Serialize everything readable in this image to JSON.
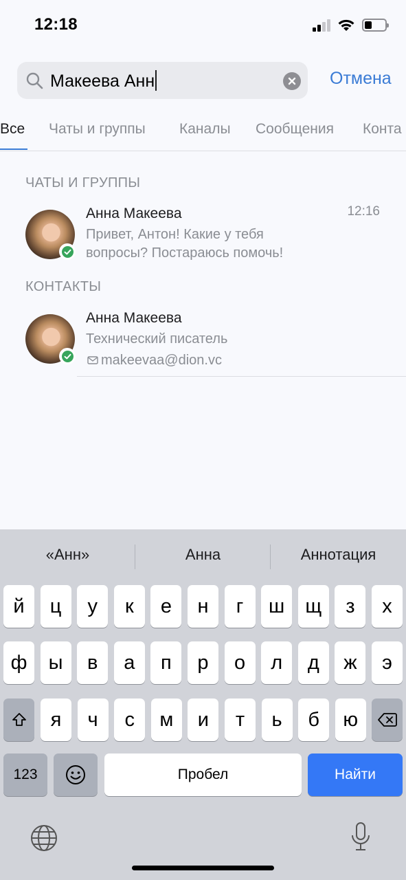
{
  "status_bar": {
    "time": "12:18"
  },
  "search": {
    "query": "Макеева Анн",
    "cancel_label": "Отмена"
  },
  "tabs": [
    {
      "label": "Все",
      "active": true
    },
    {
      "label": "Чаты и группы",
      "active": false
    },
    {
      "label": "Каналы",
      "active": false
    },
    {
      "label": "Сообщения",
      "active": false
    },
    {
      "label": "Конта",
      "active": false
    }
  ],
  "sections": {
    "chats": {
      "title": "ЧАТЫ И ГРУППЫ",
      "item": {
        "name": "Анна Макеева",
        "time": "12:16",
        "message_line1": "Привет, Антон! Какие у тебя",
        "message_line2": "вопросы? Постараюсь помочь!"
      }
    },
    "contacts": {
      "title": "КОНТАКТЫ",
      "item": {
        "name": "Анна Макеева",
        "position": "Технический писатель",
        "email": "makeevaa@dion.vc"
      }
    }
  },
  "keyboard": {
    "suggestions": [
      "«Анн»",
      "Анна",
      "Аннотация"
    ],
    "row1": [
      "й",
      "ц",
      "у",
      "к",
      "е",
      "н",
      "г",
      "ш",
      "щ",
      "з",
      "х"
    ],
    "row2": [
      "ф",
      "ы",
      "в",
      "а",
      "п",
      "р",
      "о",
      "л",
      "д",
      "ж",
      "э"
    ],
    "row3": [
      "я",
      "ч",
      "с",
      "м",
      "и",
      "т",
      "ь",
      "б",
      "ю"
    ],
    "numbers_label": "123",
    "space_label": "Пробел",
    "go_label": "Найти"
  },
  "colors": {
    "accent": "#3a7bd5",
    "online": "#37a55b",
    "go_key": "#3478f6"
  }
}
